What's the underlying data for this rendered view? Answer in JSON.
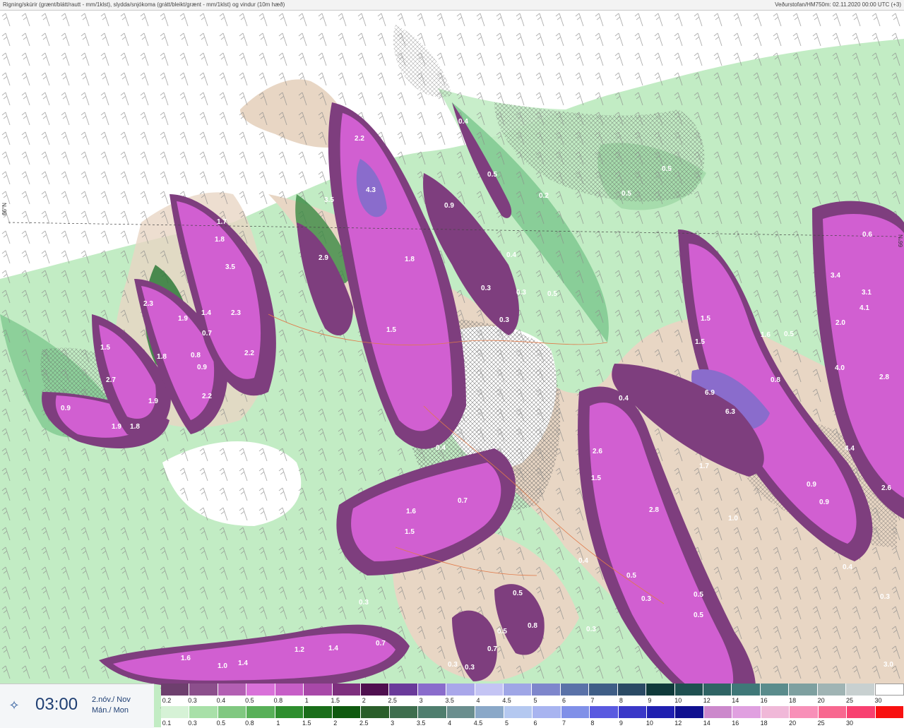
{
  "header": {
    "left_title": "Rigning/skúrir (grænt/blátt/rautt - mm/1klst), slydda/snjókoma (grátt/bleikt/grænt - mm/1klst) og vindur (10m hæð)",
    "right_title": "Veðurstofan/HM750m: 02.11.2020 00:00 UTC (+3)"
  },
  "grid_labels": {
    "left": "66°N",
    "right": "66°N"
  },
  "map_values": [
    "0.4",
    "2.2",
    "4.3",
    "0.8",
    "3.5",
    "0.9",
    "0.5",
    "0.2",
    "0.5",
    "0.5",
    "1.7",
    "1.8",
    "3.5",
    "2.9",
    "1.8",
    "0.4",
    "0.3",
    "0.3",
    "0.3",
    "0.5",
    "0.6",
    "3.4",
    "3.1",
    "4.1",
    "2.0",
    "2.3",
    "1.9",
    "1.4",
    "2.3",
    "1.5",
    "0.7",
    "2.2",
    "1.5",
    "1.8",
    "0.8",
    "0.9",
    "1.5",
    "1.5",
    "1.6",
    "2.7",
    "1.9",
    "0.9",
    "1.9",
    "1.8",
    "2.2",
    "0.5",
    "0.4",
    "6.9",
    "6.3",
    "0.8",
    "4.0",
    "2.8",
    "2.6",
    "1.5",
    "0.4",
    "1.7",
    "0.9",
    "4.4",
    "2.6",
    "0.9",
    "1.6",
    "1.5",
    "0.7",
    "2.8",
    "1.0",
    "0.4",
    "0.5",
    "0.3",
    "0.5",
    "0.5",
    "0.5",
    "0.5",
    "0.8",
    "0.4",
    "0.3",
    "0.7",
    "0.3",
    "0.3",
    "0.3",
    "0.3",
    "0.7",
    "1.6",
    "1.0",
    "1.4",
    "1.2",
    "1.4",
    "1.1",
    "3.0",
    "0.8"
  ],
  "time_panel": {
    "time": "03:00",
    "date_line1": "2.nóv./ Nov",
    "date_line2": "Mán./ Mon",
    "icon": "compass-star-icon"
  },
  "legend": {
    "snow_colors": [
      "#6e3f6e",
      "#8c4f8c",
      "#b35fb3",
      "#d971d9",
      "#c75ec7",
      "#a848a8",
      "#7e2f7e",
      "#4f0f4f",
      "#6a3a9a",
      "#8a6ccc",
      "#a9a7ea",
      "#c4c4f4",
      "#9fa6e6",
      "#7e86cc",
      "#5a72a8",
      "#3f5e86",
      "#2a4a64",
      "#0f3a3a",
      "#1f5050",
      "#2f6464",
      "#3f7878",
      "#5a8c8c",
      "#7ea0a0",
      "#a0b4b4",
      "#c8d0d0",
      "#ffffff"
    ],
    "snow_labels": [
      "0.2",
      "0.3",
      "0.4",
      "0.5",
      "0.8",
      "1",
      "1.5",
      "2",
      "2.5",
      "3",
      "3.5",
      "4",
      "4.5",
      "5",
      "6",
      "7",
      "8",
      "9",
      "10",
      "12",
      "14",
      "16",
      "18",
      "20",
      "25",
      "30"
    ],
    "rain_colors": [
      "#d6f2d6",
      "#a8e0a8",
      "#80c880",
      "#58b058",
      "#2e8e2e",
      "#1a6e1a",
      "#0f5a0f",
      "#2a5e2a",
      "#3e6e4e",
      "#4f7e6e",
      "#6a8e8e",
      "#8aa8c8",
      "#b4c8f0",
      "#a8b4f0",
      "#8090e8",
      "#5a5ae0",
      "#3a38c8",
      "#2020b0",
      "#101090",
      "#cc88cc",
      "#e0a0e0",
      "#f0b8d8",
      "#f890b8",
      "#f86890",
      "#f84070",
      "#f81010"
    ],
    "rain_labels": [
      "0.1",
      "0.3",
      "0.5",
      "0.8",
      "1",
      "1.5",
      "2",
      "2.5",
      "3",
      "3.5",
      "4",
      "4.5",
      "5",
      "6",
      "7",
      "8",
      "9",
      "10",
      "12",
      "14",
      "16",
      "18",
      "20",
      "25",
      "30"
    ]
  }
}
